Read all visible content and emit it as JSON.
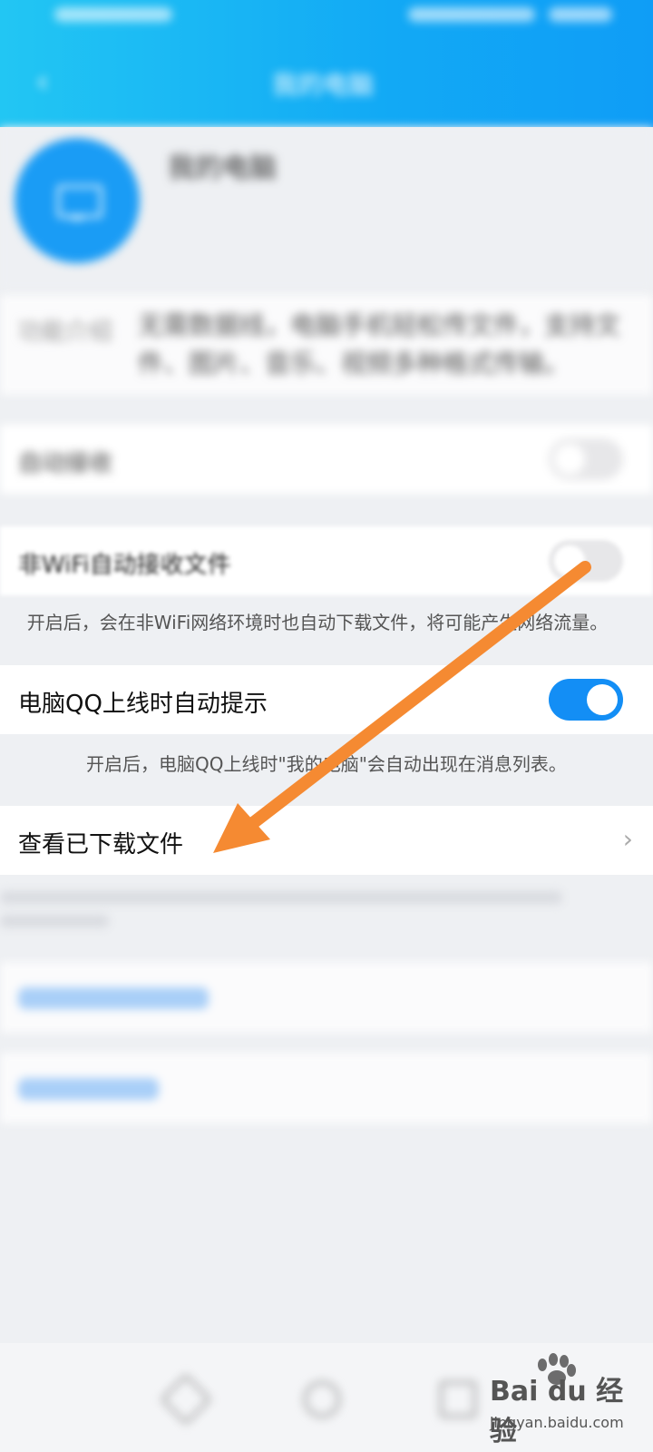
{
  "header": {
    "title": "我的电脑",
    "back_icon": "chevron-left-icon",
    "status": {
      "time": "",
      "carrier": ""
    }
  },
  "profile": {
    "device_name": "我的电脑",
    "avatar_icon": "monitor-icon"
  },
  "description": {
    "label": "功能介绍",
    "text": "无需数据线，电脑手机轻松传文件，支持文件、图片、音乐、视频多种格式传输。"
  },
  "settings": [
    {
      "label": "自动接收",
      "toggle": "off"
    },
    {
      "label": "非WiFi自动接收文件",
      "toggle": "off",
      "hint": "开启后，会在非WiFi网络环境时也自动下载文件，将可能产生网络流量。"
    },
    {
      "label": "电脑QQ上线时自动提示",
      "toggle": "on",
      "hint": "开启后，电脑QQ上线时\"我的电脑\"会自动出现在消息列表。"
    },
    {
      "label": "查看已下载文件",
      "path": ""
    }
  ],
  "links": [
    {
      "label": ""
    },
    {
      "label": ""
    }
  ],
  "navbar": {
    "icons": [
      "back-triangle-icon",
      "home-circle-icon",
      "recent-square-icon"
    ]
  },
  "watermark": {
    "brand": "Bai du 经验",
    "url": "jingyan.baidu.com"
  },
  "colors": {
    "header_start": "#22c6f3",
    "header_end": "#0f9df6",
    "toggle_on": "#138ef5",
    "arrow": "#f58a32"
  }
}
